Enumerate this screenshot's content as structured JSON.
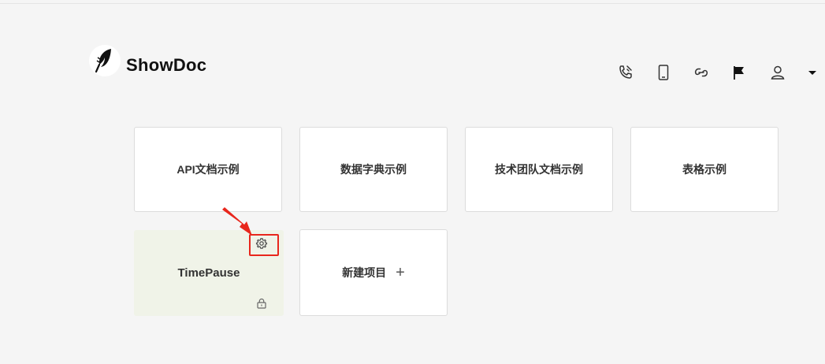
{
  "app": {
    "title": "ShowDoc"
  },
  "toolbar": {
    "items": [
      {
        "name": "phone-icon"
      },
      {
        "name": "mobile-icon"
      },
      {
        "name": "link-icon"
      },
      {
        "name": "flag-icon"
      },
      {
        "name": "user-icon"
      },
      {
        "name": "dropdown-caret-icon"
      }
    ]
  },
  "projects": [
    {
      "label": "API文档示例"
    },
    {
      "label": "数据字典示例"
    },
    {
      "label": "技术团队文档示例"
    },
    {
      "label": "表格示例"
    },
    {
      "label": "TimePause",
      "private": true
    }
  ],
  "new_project": {
    "label": "新建项目",
    "icon": "plus-icon"
  },
  "colors": {
    "background": "#f5f5f5",
    "card": "#ffffff",
    "private_card": "#f0f3e8",
    "annotation": "#e8261c"
  }
}
